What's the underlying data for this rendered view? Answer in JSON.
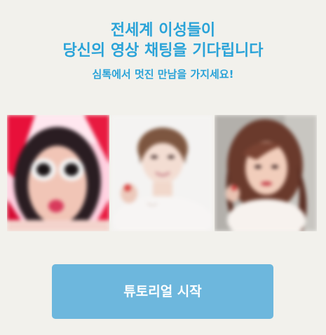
{
  "header": {
    "title_line1": "전세계 이성들이",
    "title_line2": "당신의 영상 채팅을 기다립니다",
    "subtitle": "심톡에서 멋진 만남을 가지세요!"
  },
  "photos": [
    {
      "name": "profile-photo-1"
    },
    {
      "name": "profile-photo-2"
    },
    {
      "name": "profile-photo-3"
    }
  ],
  "cta": {
    "label": "튜토리얼 시작"
  },
  "colors": {
    "background": "#f2f1ec",
    "accent_text": "#2aa3d8",
    "button": "#6db7dd",
    "button_text": "#ffffff"
  }
}
